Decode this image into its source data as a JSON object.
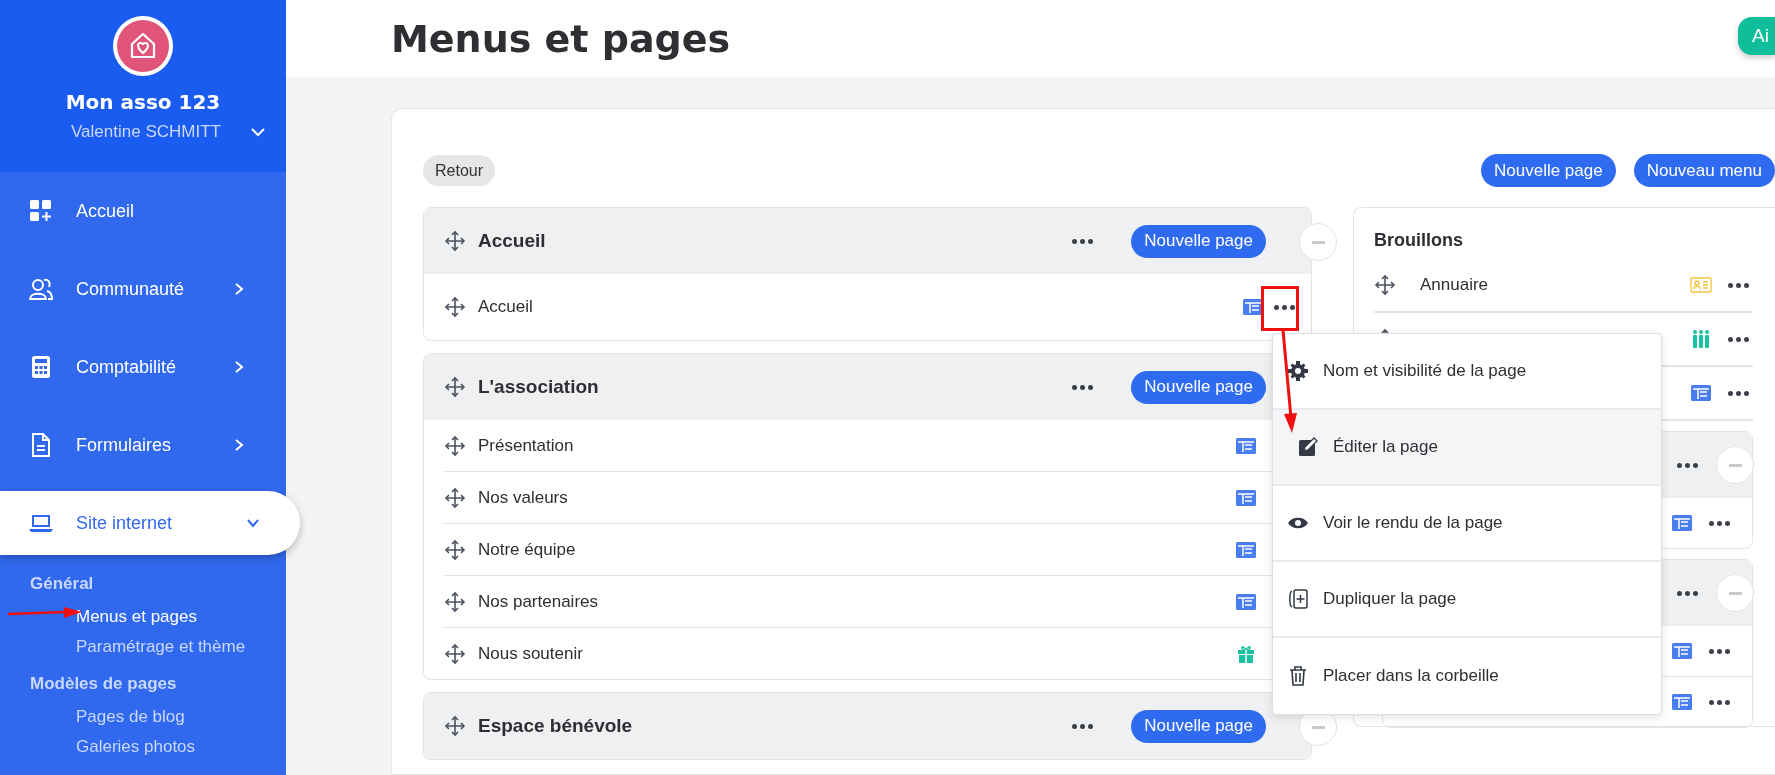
{
  "sidebar": {
    "org_name": "Mon asso 123",
    "user_name": "Valentine SCHMITT",
    "nav": [
      {
        "label": "Accueil",
        "kind": "dashboard",
        "has_children": false,
        "expanded": false,
        "selected": false
      },
      {
        "label": "Communauté",
        "kind": "people",
        "has_children": true,
        "expanded": false,
        "selected": false
      },
      {
        "label": "Comptabilité",
        "kind": "calculator",
        "has_children": true,
        "expanded": false,
        "selected": false
      },
      {
        "label": "Formulaires",
        "kind": "document",
        "has_children": true,
        "expanded": false,
        "selected": false
      },
      {
        "label": "Site internet",
        "kind": "laptop",
        "has_children": true,
        "expanded": true,
        "selected": true
      }
    ],
    "subnav": [
      {
        "heading": "Général",
        "items": [
          {
            "label": "Menus et pages",
            "selected": true
          },
          {
            "label": "Paramétrage et thème",
            "selected": false
          }
        ]
      },
      {
        "heading": "Modèles de pages",
        "items": [
          {
            "label": "Pages de blog",
            "selected": false
          },
          {
            "label": "Galeries photos",
            "selected": false
          }
        ]
      }
    ]
  },
  "page": {
    "title": "Menus et pages",
    "help_button": "Ai"
  },
  "toolbar": {
    "back": "Retour",
    "buttons": [
      "Nouvelle page",
      "Nouveau menu"
    ]
  },
  "menus": [
    {
      "title": "Accueil",
      "new_page": "Nouvelle page",
      "pages": [
        {
          "label": "Accueil",
          "kind": "layout",
          "hovered": true
        }
      ]
    },
    {
      "title": "L'association",
      "new_page": "Nouvelle page",
      "pages": [
        {
          "label": "Présentation",
          "kind": "layout",
          "hovered": false
        },
        {
          "label": "Nos valeurs",
          "kind": "layout",
          "hovered": false
        },
        {
          "label": "Notre équipe",
          "kind": "layout",
          "hovered": false
        },
        {
          "label": "Nos partenaires",
          "kind": "layout",
          "hovered": false
        },
        {
          "label": "Nous soutenir",
          "kind": "gift",
          "hovered": false
        }
      ]
    },
    {
      "title": "Espace bénévole",
      "new_page": "Nouvelle page"
    }
  ],
  "drafts": {
    "title": "Brouillons",
    "pages": [
      {
        "label": "Annuaire",
        "kind": "contact"
      },
      {
        "kind": "people"
      },
      {
        "kind": "layout"
      }
    ],
    "menus": [
      {
        "pages": [
          {
            "kind": "layout"
          }
        ]
      },
      {
        "pages": [
          {
            "kind": "layout"
          },
          {
            "kind": "layout"
          }
        ]
      }
    ]
  },
  "context_menu": {
    "items": [
      {
        "label": "Nom et visibilité de la page",
        "kind": "gear",
        "selected": false
      },
      {
        "label": "Éditer la page",
        "kind": "edit",
        "selected": true
      },
      {
        "label": "Voir le rendu de la page",
        "kind": "eye",
        "selected": false
      },
      {
        "label": "Dupliquer la page",
        "kind": "duplicate",
        "selected": false
      },
      {
        "label": "Placer dans la corbeille",
        "kind": "trash",
        "selected": false
      }
    ]
  }
}
